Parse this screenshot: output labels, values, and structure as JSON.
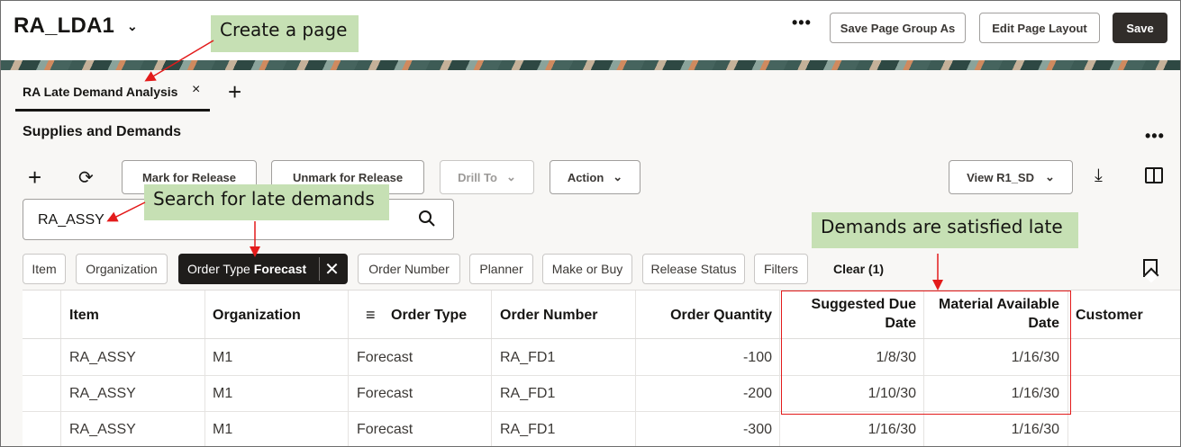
{
  "header": {
    "title": "RA_LDA1",
    "more_label": "•••",
    "save_group_label": "Save Page Group As",
    "edit_layout_label": "Edit Page Layout",
    "save_label": "Save"
  },
  "tabs": {
    "active_label": "RA Late Demand Analysis",
    "close_glyph": "×",
    "add_glyph": "+"
  },
  "section": {
    "title": "Supplies and Demands",
    "more_label": "•••"
  },
  "toolbar": {
    "mark_label": "Mark for Release",
    "unmark_label": "Unmark for Release",
    "drill_label": "Drill To",
    "action_label": "Action",
    "view_label": "View R1_SD"
  },
  "search": {
    "value": "RA_ASSY"
  },
  "chips": {
    "item": "Item",
    "organization": "Organization",
    "order_type_name": "Order Type",
    "order_type_value": "Forecast",
    "order_number": "Order Number",
    "planner": "Planner",
    "make_or_buy": "Make or Buy",
    "release_status": "Release Status",
    "filters": "Filters",
    "clear": "Clear (1)"
  },
  "table": {
    "headers": {
      "item": "Item",
      "organization": "Organization",
      "order_type": "Order Type",
      "order_number": "Order Number",
      "order_quantity": "Order Quantity",
      "suggested_due_1": "Suggested Due",
      "suggested_due_2": "Date",
      "material_available_1": "Material Available",
      "material_available_2": "Date",
      "customer": "Customer"
    },
    "rows": [
      {
        "item": "RA_ASSY",
        "organization": "M1",
        "order_type": "Forecast",
        "order_number": "RA_FD1",
        "quantity": "-100",
        "suggested_due": "1/8/30",
        "material_available": "1/16/30"
      },
      {
        "item": "RA_ASSY",
        "organization": "M1",
        "order_type": "Forecast",
        "order_number": "RA_FD1",
        "quantity": "-200",
        "suggested_due": "1/10/30",
        "material_available": "1/16/30"
      },
      {
        "item": "RA_ASSY",
        "organization": "M1",
        "order_type": "Forecast",
        "order_number": "RA_FD1",
        "quantity": "-300",
        "suggested_due": "1/16/30",
        "material_available": "1/16/30"
      }
    ]
  },
  "annotations": {
    "create_page": "Create a page",
    "search_late": "Search for late demands",
    "satisfied_late": "Demands are satisfied late"
  },
  "colors": {
    "callout_bg": "#c6e0b4",
    "annotation_red": "#e31b1b",
    "primary_button": "#312d2a"
  }
}
